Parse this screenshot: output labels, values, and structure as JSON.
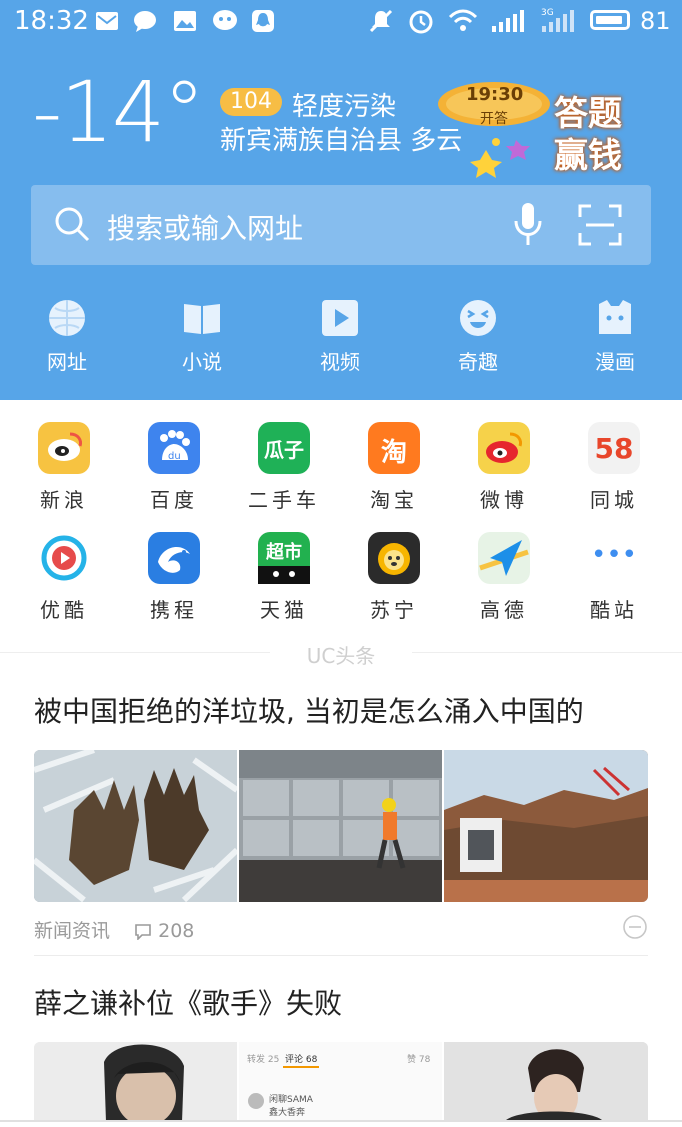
{
  "status_bar": {
    "time": "18:32",
    "battery": "81",
    "signal_label": "3G"
  },
  "weather": {
    "temperature": "-14°",
    "aqi_value": "104",
    "aqi_text": "轻度污染",
    "location": "新宾满族自治县 多云"
  },
  "promo": {
    "time": "19:30",
    "sub": "开答",
    "title_line1": "答题",
    "title_line2": "赢钱"
  },
  "search": {
    "placeholder": "搜索或输入网址"
  },
  "nav": [
    {
      "label": "网址",
      "icon": "globe-icon"
    },
    {
      "label": "小说",
      "icon": "book-icon"
    },
    {
      "label": "视频",
      "icon": "play-icon"
    },
    {
      "label": "奇趣",
      "icon": "smiley-icon"
    },
    {
      "label": "漫画",
      "icon": "comic-icon"
    }
  ],
  "apps": [
    {
      "label": "新浪",
      "icon": "sina-icon",
      "color": "#f7c341",
      "glyph": "◉"
    },
    {
      "label": "百度",
      "icon": "baidu-icon",
      "color": "#3e84ee",
      "glyph": "du"
    },
    {
      "label": "二手车",
      "icon": "guazi-icon",
      "color": "#1fb157",
      "glyph": "瓜子"
    },
    {
      "label": "淘宝",
      "icon": "taobao-icon",
      "color": "#ff7a1f",
      "glyph": "淘"
    },
    {
      "label": "微博",
      "icon": "weibo-icon",
      "color": "#f6d24a",
      "glyph": "◉"
    },
    {
      "label": "同城",
      "icon": "58-icon",
      "color": "#f2f2f2",
      "glyph": "58"
    },
    {
      "label": "优酷",
      "icon": "youku-icon",
      "color": "#ffffff",
      "glyph": "▶"
    },
    {
      "label": "携程",
      "icon": "ctrip-icon",
      "color": "#2a7ee2",
      "glyph": "◠"
    },
    {
      "label": "天猫",
      "icon": "tmall-icon",
      "color": "#22b14f",
      "glyph": "超市"
    },
    {
      "label": "苏宁",
      "icon": "suning-icon",
      "color": "#2b2b2b",
      "glyph": "●"
    },
    {
      "label": "高德",
      "icon": "amap-icon",
      "color": "#e7f3e6",
      "glyph": "➤"
    },
    {
      "label": "酷站",
      "icon": "more-icon",
      "color": "#ffffff",
      "glyph": "•••"
    }
  ],
  "feed": {
    "section_label": "UC头条",
    "articles": [
      {
        "title": "被中国拒绝的洋垃圾, 当初是怎么涌入中国的",
        "category": "新闻资讯",
        "comments": "208"
      },
      {
        "title": "薛之谦补位《歌手》失败",
        "inner_snippet": {
          "tab1": "转发 25",
          "tab2": "评论 68",
          "tab3": "赞 78",
          "name": "闲聊SAMA",
          "sub": "鑫大香奔"
        }
      }
    ]
  },
  "colors": {
    "header_bg": "#57a5e8",
    "search_bg": "#86bdee",
    "aqi_badge": "#f7bd45"
  }
}
